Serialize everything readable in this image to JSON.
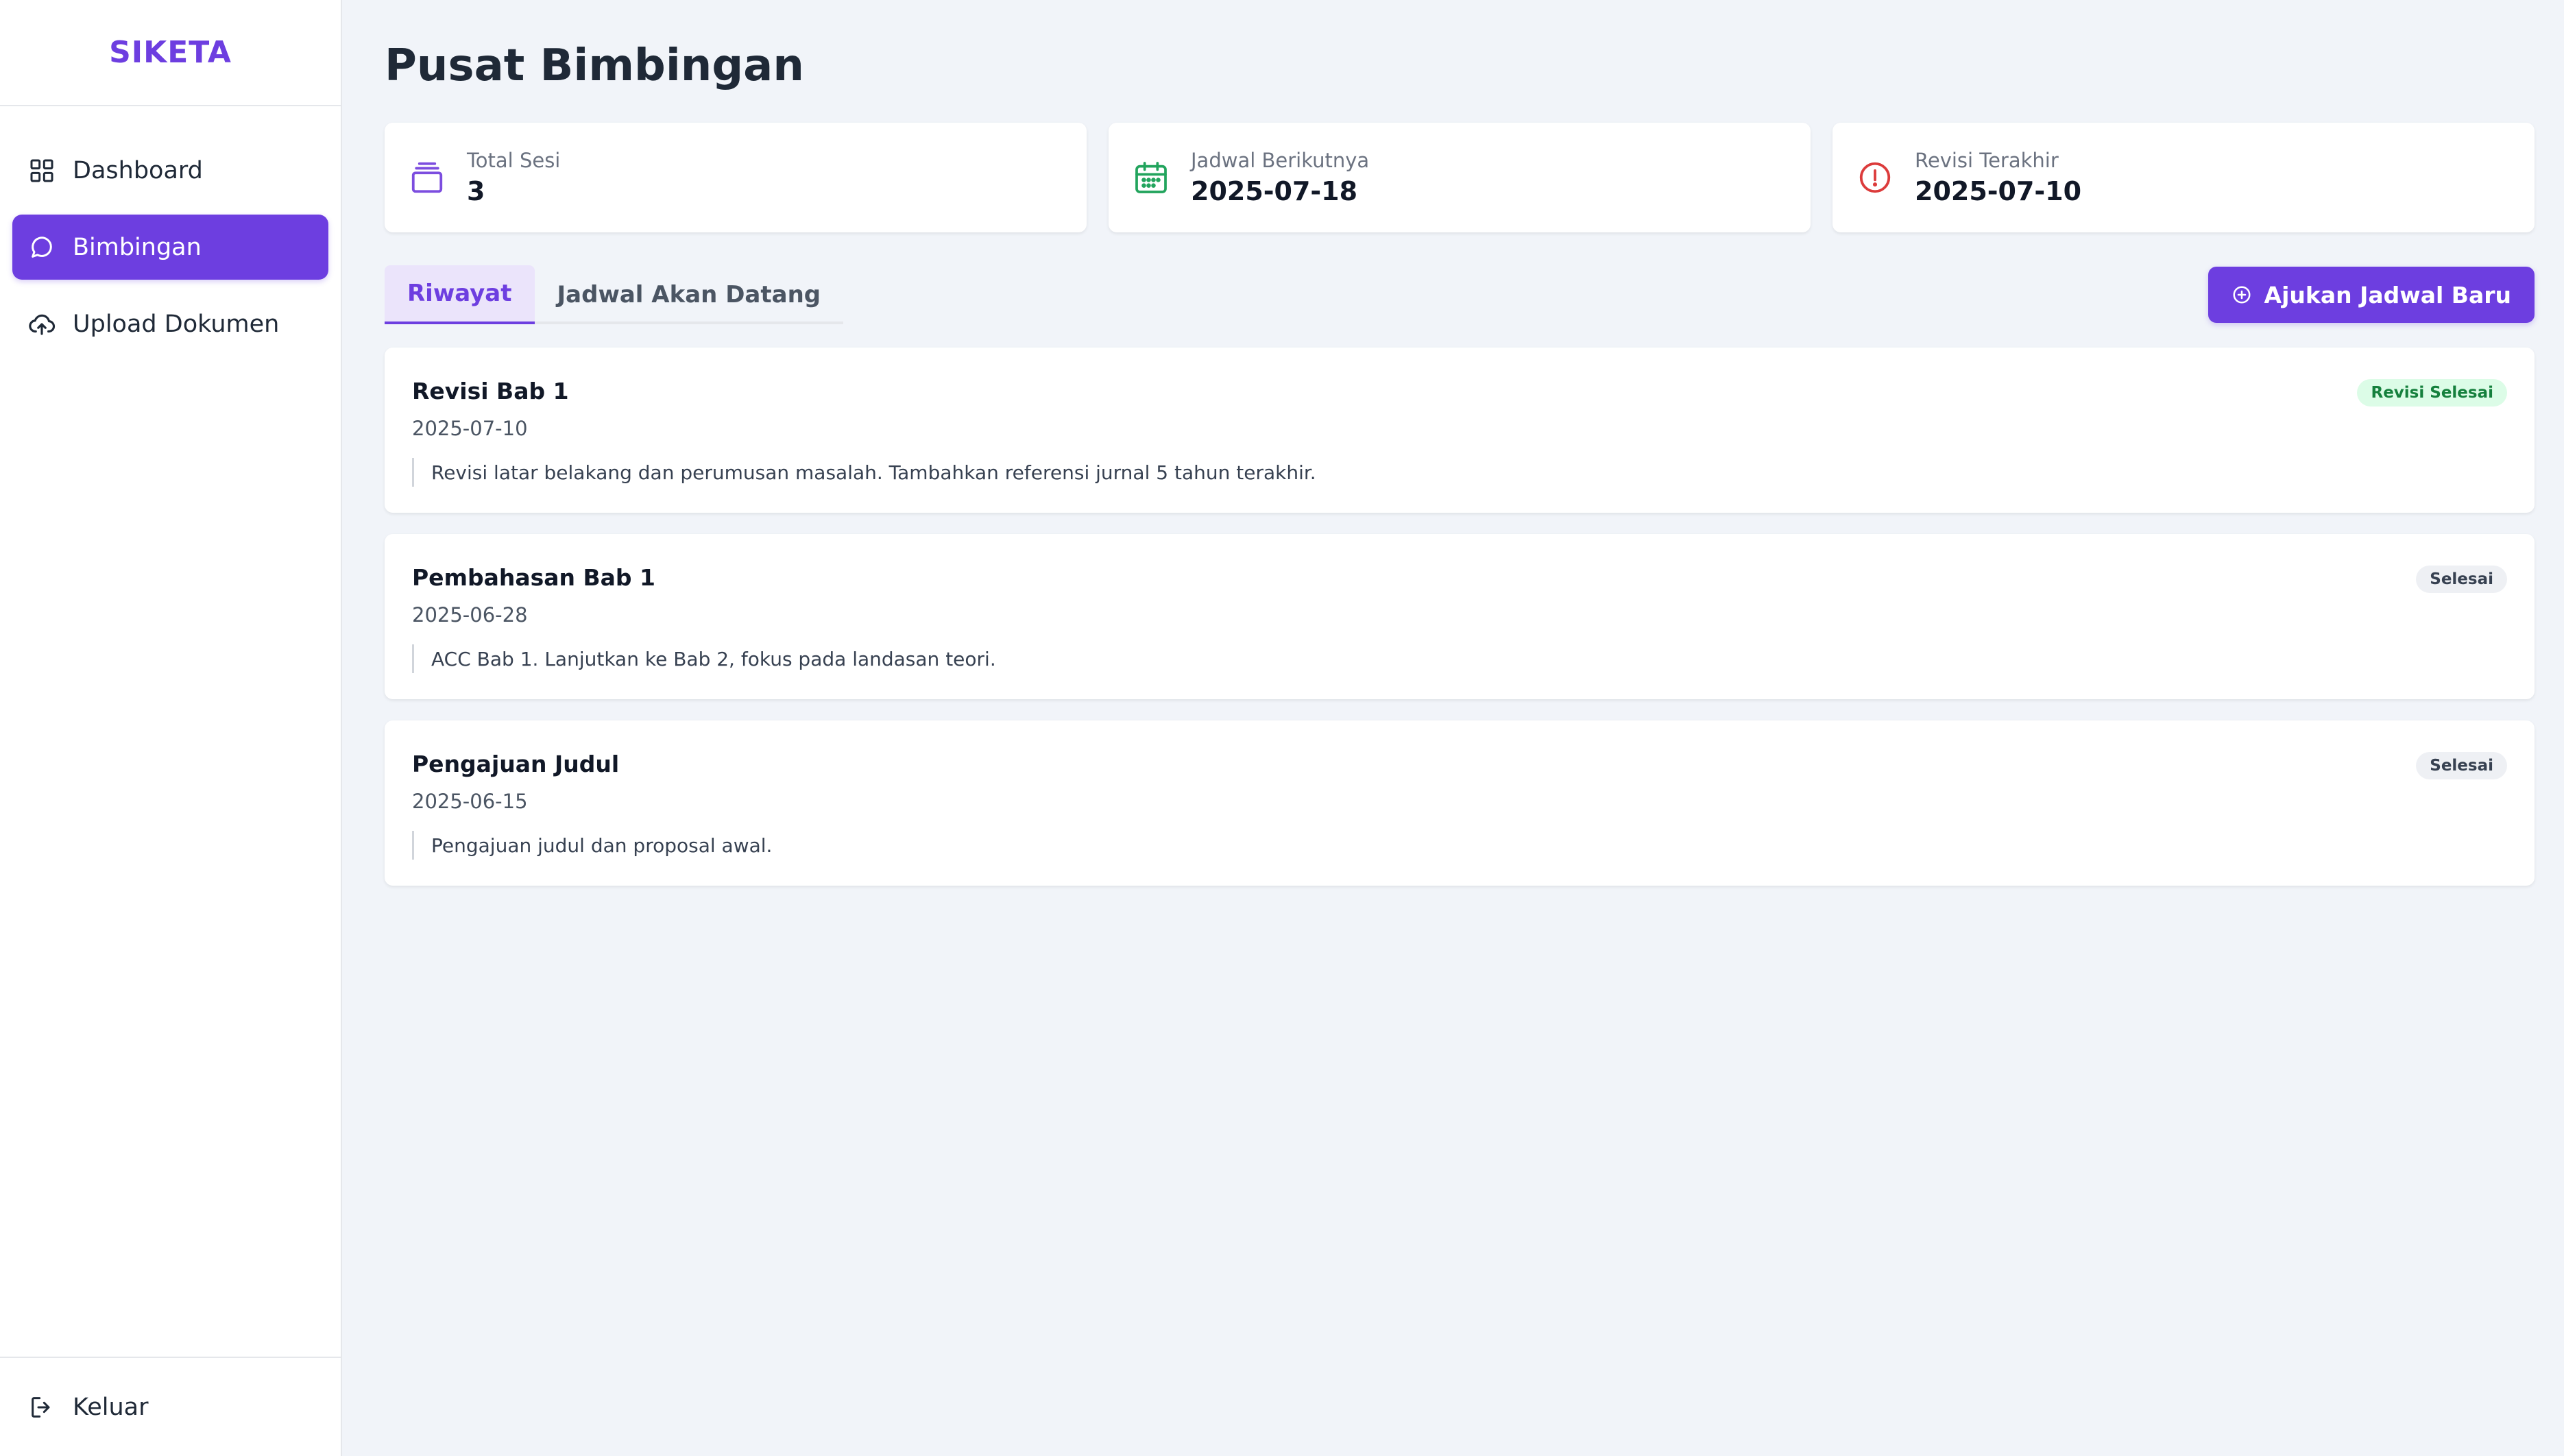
{
  "brand": "SIKETA",
  "sidebar": {
    "items": [
      {
        "label": "Dashboard",
        "icon": "grid-icon"
      },
      {
        "label": "Bimbingan",
        "icon": "chat-icon"
      },
      {
        "label": "Upload Dokumen",
        "icon": "cloud-upload-icon"
      }
    ],
    "logout_label": "Keluar"
  },
  "page_title": "Pusat Bimbingan",
  "stats": [
    {
      "label": "Total Sesi",
      "value": "3",
      "icon": "layers-icon",
      "color": "#7c4ddf"
    },
    {
      "label": "Jadwal Berikutnya",
      "value": "2025-07-18",
      "icon": "calendar-icon",
      "color": "#22a45d"
    },
    {
      "label": "Revisi Terakhir",
      "value": "2025-07-10",
      "icon": "alert-circle-icon",
      "color": "#dc3b3b"
    }
  ],
  "tabs": [
    {
      "label": "Riwayat"
    },
    {
      "label": "Jadwal Akan Datang"
    }
  ],
  "actions": {
    "new_schedule_label": "Ajukan Jadwal Baru"
  },
  "sessions": [
    {
      "title": "Revisi Bab 1",
      "date": "2025-07-10",
      "note": "Revisi latar belakang dan perumusan masalah. Tambahkan referensi jurnal 5 tahun terakhir.",
      "status": "Revisi Selesai"
    },
    {
      "title": "Pembahasan Bab 1",
      "date": "2025-06-28",
      "note": "ACC Bab 1. Lanjutkan ke Bab 2, fokus pada landasan teori.",
      "status": "Selesai"
    },
    {
      "title": "Pengajuan Judul",
      "date": "2025-06-15",
      "note": "Pengajuan judul dan proposal awal.",
      "status": "Selesai"
    }
  ],
  "colors": {
    "accent": "#6d3ee0",
    "success": "#15803d",
    "background": "#f1f4f9"
  }
}
